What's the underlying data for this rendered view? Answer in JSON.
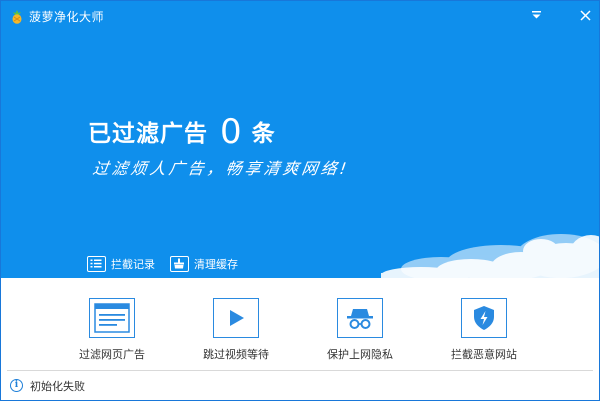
{
  "window": {
    "title": "菠萝净化大师"
  },
  "hero": {
    "headline_prefix": "已过滤广告",
    "count": "0",
    "headline_suffix": "条",
    "slogan": "过滤烦人广告，畅享清爽网络!"
  },
  "actions": {
    "log_label": "拦截记录",
    "cache_label": "清理缓存"
  },
  "features": [
    {
      "label": "过滤网页广告",
      "icon": "webpage-icon"
    },
    {
      "label": "跳过视频等待",
      "icon": "play-icon"
    },
    {
      "label": "保护上网隐私",
      "icon": "incognito-icon"
    },
    {
      "label": "拦截恶意网站",
      "icon": "shield-icon"
    }
  ],
  "status": {
    "text": "初始化失败",
    "icon": "info-icon"
  },
  "colors": {
    "hero_bg": "#0f8fec",
    "accent": "#2a8ae0",
    "text": "#333333"
  }
}
